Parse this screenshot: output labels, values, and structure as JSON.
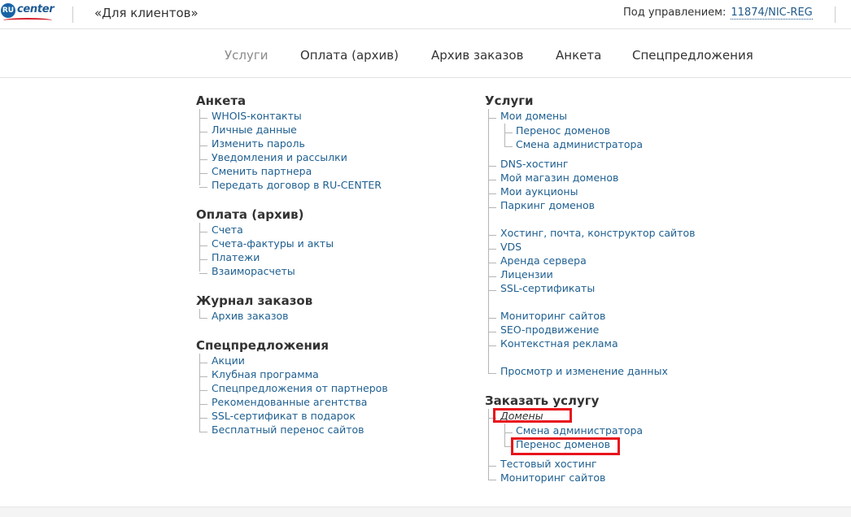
{
  "header": {
    "logo_ru": "RU",
    "logo_word": "center",
    "client_title": "«Для клиентов»",
    "managed_label": "Под управлением:",
    "managed_value": "11874/NIC-REG"
  },
  "nav": {
    "services": "Услуги",
    "payment": "Оплата (архив)",
    "orders": "Архив заказов",
    "profile": "Анкета",
    "offers": "Спецпредложения"
  },
  "left": {
    "profile": {
      "title": "Анкета",
      "items": [
        "WHOIS-контакты",
        "Личные данные",
        "Изменить пароль",
        "Уведомления и рассылки",
        "Сменить партнера",
        "Передать договор в RU-CENTER"
      ]
    },
    "payment": {
      "title": "Оплата (архив)",
      "items": [
        "Счета",
        "Счета-фактуры и акты",
        "Платежи",
        "Взаиморасчеты"
      ]
    },
    "orders": {
      "title": "Журнал заказов",
      "items": [
        "Архив заказов"
      ]
    },
    "offers": {
      "title": "Спецпредложения",
      "items": [
        "Акции",
        "Клубная программа",
        "Спецпредложения от партнеров",
        "Рекомендованные агентства",
        "SSL-сертификат в подарок",
        "Бесплатный перенос сайтов"
      ]
    }
  },
  "right": {
    "services": {
      "title": "Услуги",
      "my_domains": "Мои домены",
      "domain_transfer": "Перенос доменов",
      "admin_change": "Смена администратора",
      "items": [
        "DNS-хостинг",
        "Мой магазин доменов",
        "Мои аукционы",
        "Паркинг доменов",
        "Хостинг, почта, конструктор сайтов",
        "VDS",
        "Аренда сервера",
        "Лицензии",
        "SSL-сертификаты",
        "Мониторинг сайтов",
        "SEO-продвижение",
        "Контекстная реклама",
        "Просмотр и изменение данных"
      ]
    },
    "order": {
      "title": "Заказать услугу",
      "domains": "Домены",
      "admin_change": "Смена администратора",
      "domain_transfer": "Перенос доменов",
      "test_hosting": "Тестовый хостинг",
      "monitoring": "Мониторинг сайтов"
    }
  },
  "colors": {
    "link": "#1e5f90",
    "highlight": "#e8141c",
    "brand_blue": "#1763a6",
    "brand_red": "#d5202a"
  }
}
